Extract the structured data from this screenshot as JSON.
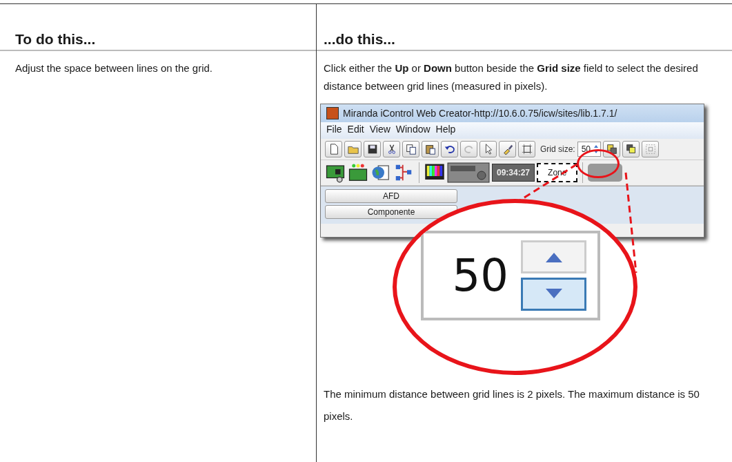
{
  "table": {
    "columns": [
      "To do this...",
      "...do this..."
    ],
    "rows": [
      {
        "action": "Adjust the space between lines on the grid.",
        "instruction": "Click either the **Up** or **Down** button beside the **Grid size** field to select the desired distance between grid lines (measured in pixels).",
        "note": "The minimum distance between grid lines is 2 pixels. The maximum distance is 50 pixels."
      }
    ]
  },
  "screenshot": {
    "title": "Miranda iControl Web Creator-http://10.6.0.75/icw/sites/lib.1.7.1/",
    "menu": [
      "File",
      "Edit",
      "View",
      "Window",
      "Help"
    ],
    "grid_size": {
      "label": "Grid size:",
      "value": "50"
    },
    "clock": "09:34:27",
    "zone": "Zone",
    "tabs": [
      "AFD",
      "Componente"
    ],
    "magnifier": {
      "value": "50",
      "down_pressed": true
    }
  }
}
